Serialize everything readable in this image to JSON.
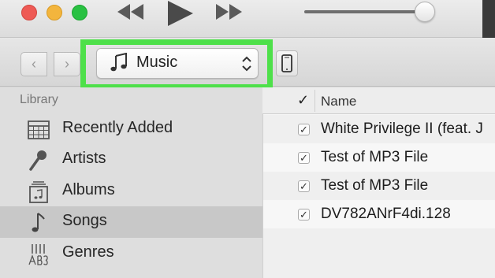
{
  "player": {
    "controls": [
      "rewind-icon",
      "play-icon",
      "fast-forward-icon"
    ]
  },
  "toolbar": {
    "back_glyph": "‹",
    "forward_glyph": "›",
    "source_selector": {
      "label": "Music",
      "icon": "music-note-icon"
    },
    "device_icon": "iphone-icon",
    "highlight_color": "#4ee04a"
  },
  "sidebar": {
    "section_title": "Library",
    "items": [
      {
        "label": "Recently Added",
        "icon": "calendar-grid-icon",
        "selected": false
      },
      {
        "label": "Artists",
        "icon": "microphone-icon",
        "selected": false
      },
      {
        "label": "Albums",
        "icon": "album-stack-icon",
        "selected": false
      },
      {
        "label": "Songs",
        "icon": "music-note-icon",
        "selected": true
      },
      {
        "label": "Genres",
        "icon": "genres-icon",
        "selected": false
      }
    ]
  },
  "list": {
    "header_check": "✓",
    "name_column": "Name",
    "songs": [
      {
        "title": "White Privilege II (feat. J",
        "checked": "✓"
      },
      {
        "title": "Test of MP3 File",
        "checked": "✓"
      },
      {
        "title": "Test of MP3 File",
        "checked": "✓"
      },
      {
        "title": "DV782ANrF4di.128",
        "checked": "✓"
      }
    ]
  }
}
